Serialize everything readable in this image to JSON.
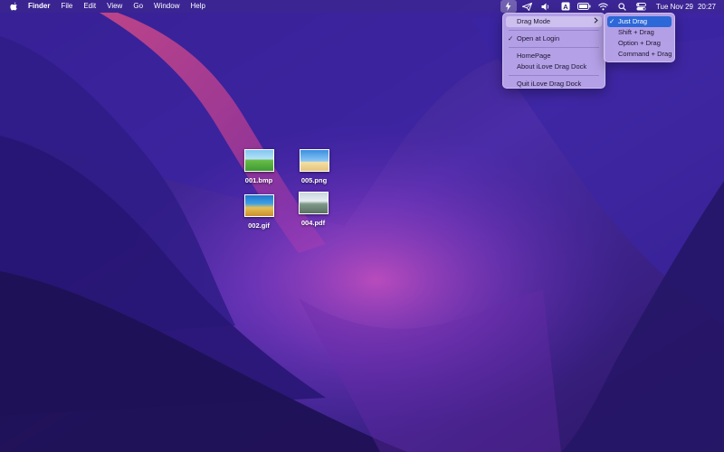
{
  "menubar": {
    "app_name": "Finder",
    "items": [
      "File",
      "Edit",
      "View",
      "Go",
      "Window",
      "Help"
    ],
    "status_icons": [
      "lightning-icon",
      "paper-plane-icon",
      "speaker-icon",
      "input-source-icon",
      "battery-icon",
      "wifi-icon",
      "search-icon",
      "control-center-icon"
    ],
    "input_source_letter": "A",
    "clock": {
      "date": "Tue Nov 29",
      "time": "20:27"
    }
  },
  "main_menu": {
    "drag_mode": "Drag Mode",
    "open_at_login": "Open at Login",
    "open_at_login_checked": true,
    "homepage": "HomePage",
    "about": "About iLove Drag Dock",
    "quit": "Quit iLove Drag Dock"
  },
  "drag_mode_submenu": {
    "items": [
      "Just Drag",
      "Shift + Drag",
      "Option + Drag",
      "Command + Drag"
    ],
    "selected": "Just Drag"
  },
  "desktop_files": [
    "001.bmp",
    "005.png",
    "002.gif",
    "004.pdf"
  ],
  "colors": {
    "selection": "#2c68d8",
    "menu_bg": "#beaaeb"
  }
}
